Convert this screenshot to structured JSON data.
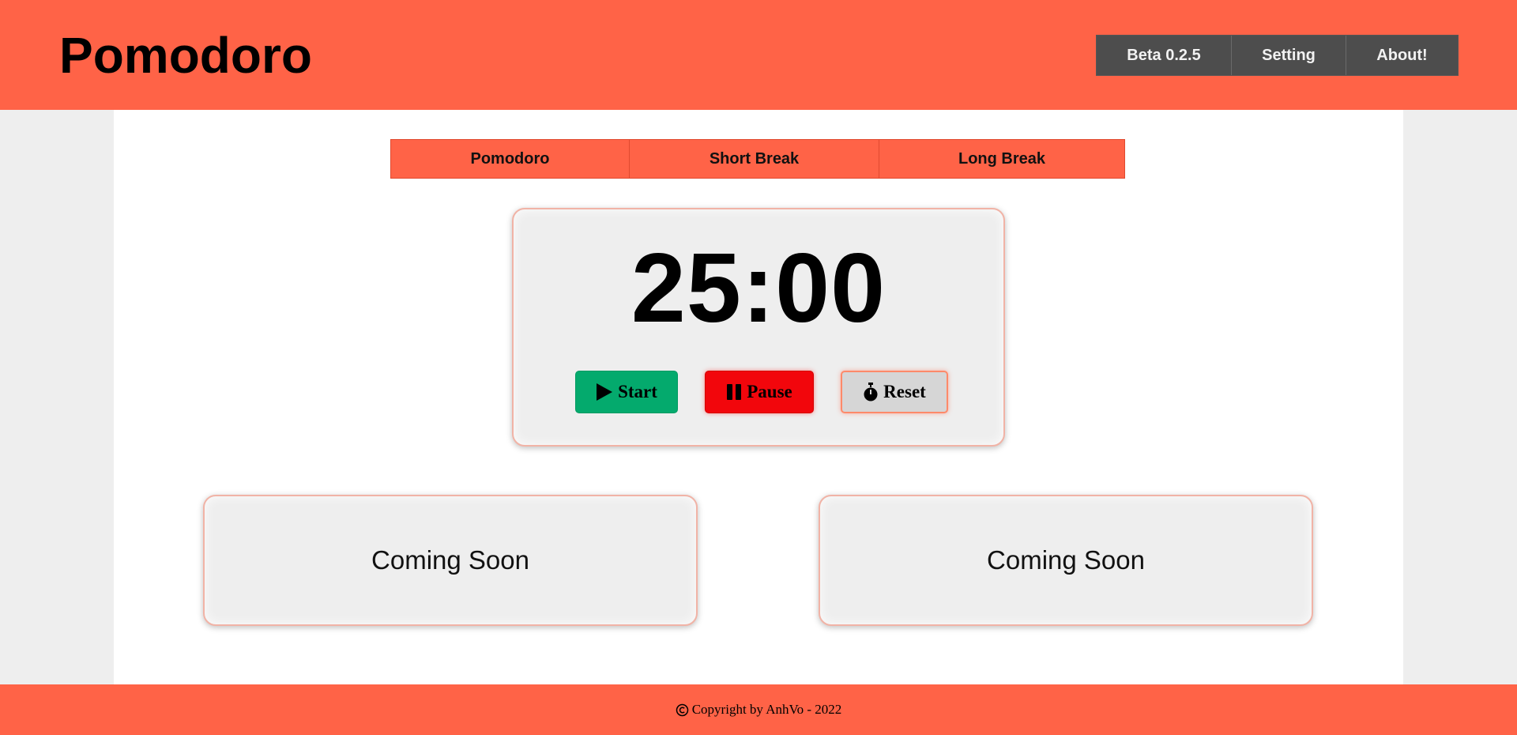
{
  "header": {
    "title": "Pomodoro",
    "nav": [
      {
        "label": "Beta 0.2.5",
        "icon": null
      },
      {
        "label": "Setting",
        "icon": null
      },
      {
        "label": "About!",
        "icon": null
      }
    ]
  },
  "modes": [
    {
      "label": "Pomodoro"
    },
    {
      "label": "Short Break"
    },
    {
      "label": "Long Break"
    }
  ],
  "timer": {
    "display": "25:00",
    "start_label": "Start",
    "start_icon": "play-icon",
    "pause_label": "Pause",
    "pause_icon": "pause-icon",
    "reset_label": "Reset",
    "reset_icon": "stopwatch-icon"
  },
  "panels": [
    {
      "label": "Coming Soon"
    },
    {
      "label": "Coming Soon"
    }
  ],
  "footer": {
    "icon": "copyright-icon",
    "text": "Copyright by AnhVo - 2022"
  },
  "colors": {
    "brand": "#ff6347",
    "nav_bg": "#4d4d4d",
    "start": "#04aa6d",
    "pause": "#f2060c",
    "reset": "#d6d6d6",
    "card_bg": "#eeeeee"
  }
}
